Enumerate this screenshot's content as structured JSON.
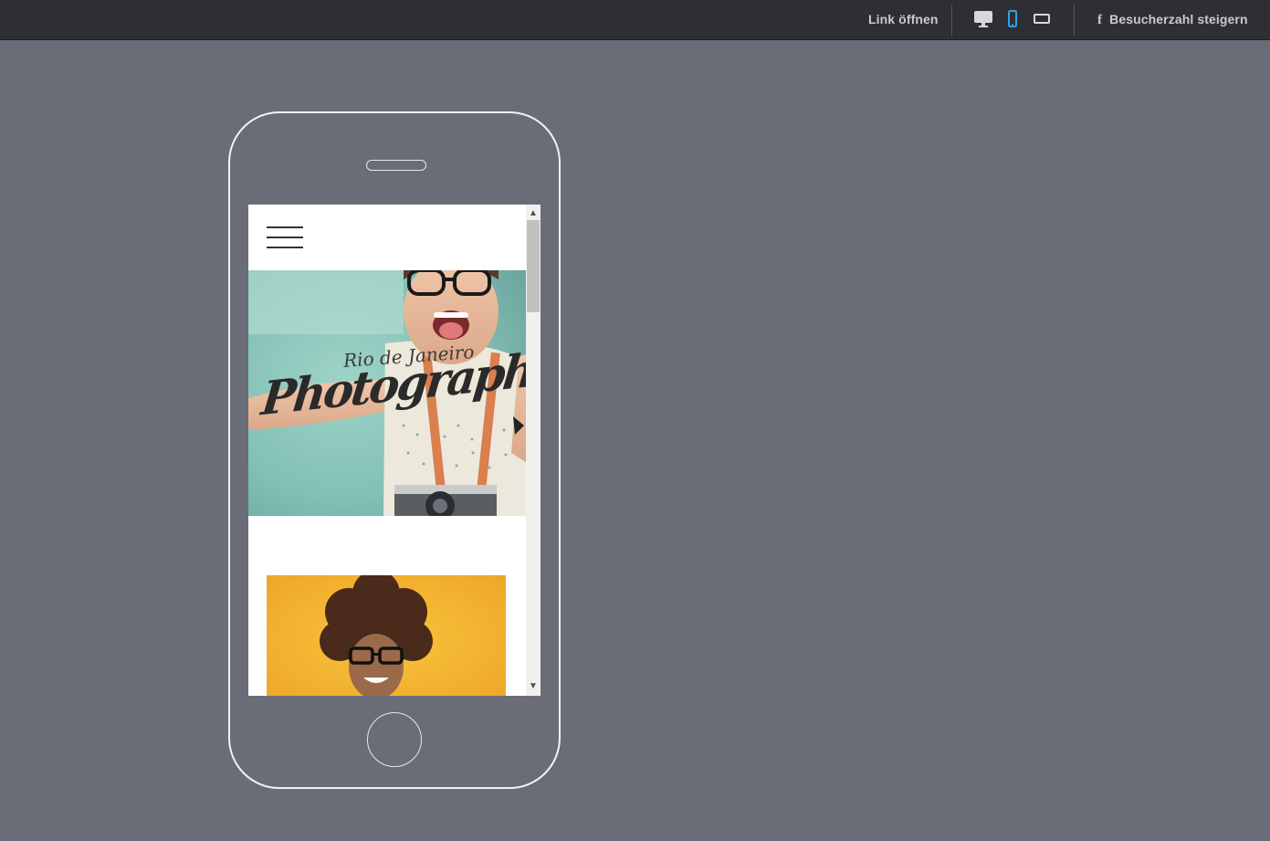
{
  "topbar": {
    "open_link_label": "Link öffnen",
    "devices": [
      {
        "name": "desktop",
        "icon": "monitor-icon",
        "active": false
      },
      {
        "name": "mobile",
        "icon": "smartphone-icon",
        "active": true
      },
      {
        "name": "tablet",
        "icon": "tablet-landscape-icon",
        "active": false
      }
    ],
    "facebook_icon": "facebook-icon",
    "promote_label": "Besucherzahl steigern"
  },
  "site": {
    "menu_icon": "hamburger-menu-icon",
    "hero": {
      "subtitle": "Rio de Janeiro",
      "title": "Photography"
    }
  },
  "colors": {
    "topbar_bg": "#2e2f33",
    "page_bg": "#6a6c78",
    "active_device": "#2fa3e6",
    "inactive_device": "#d7d8dd",
    "hero_bg": "#8fc7bd",
    "portrait_bg": "#f2b733"
  }
}
